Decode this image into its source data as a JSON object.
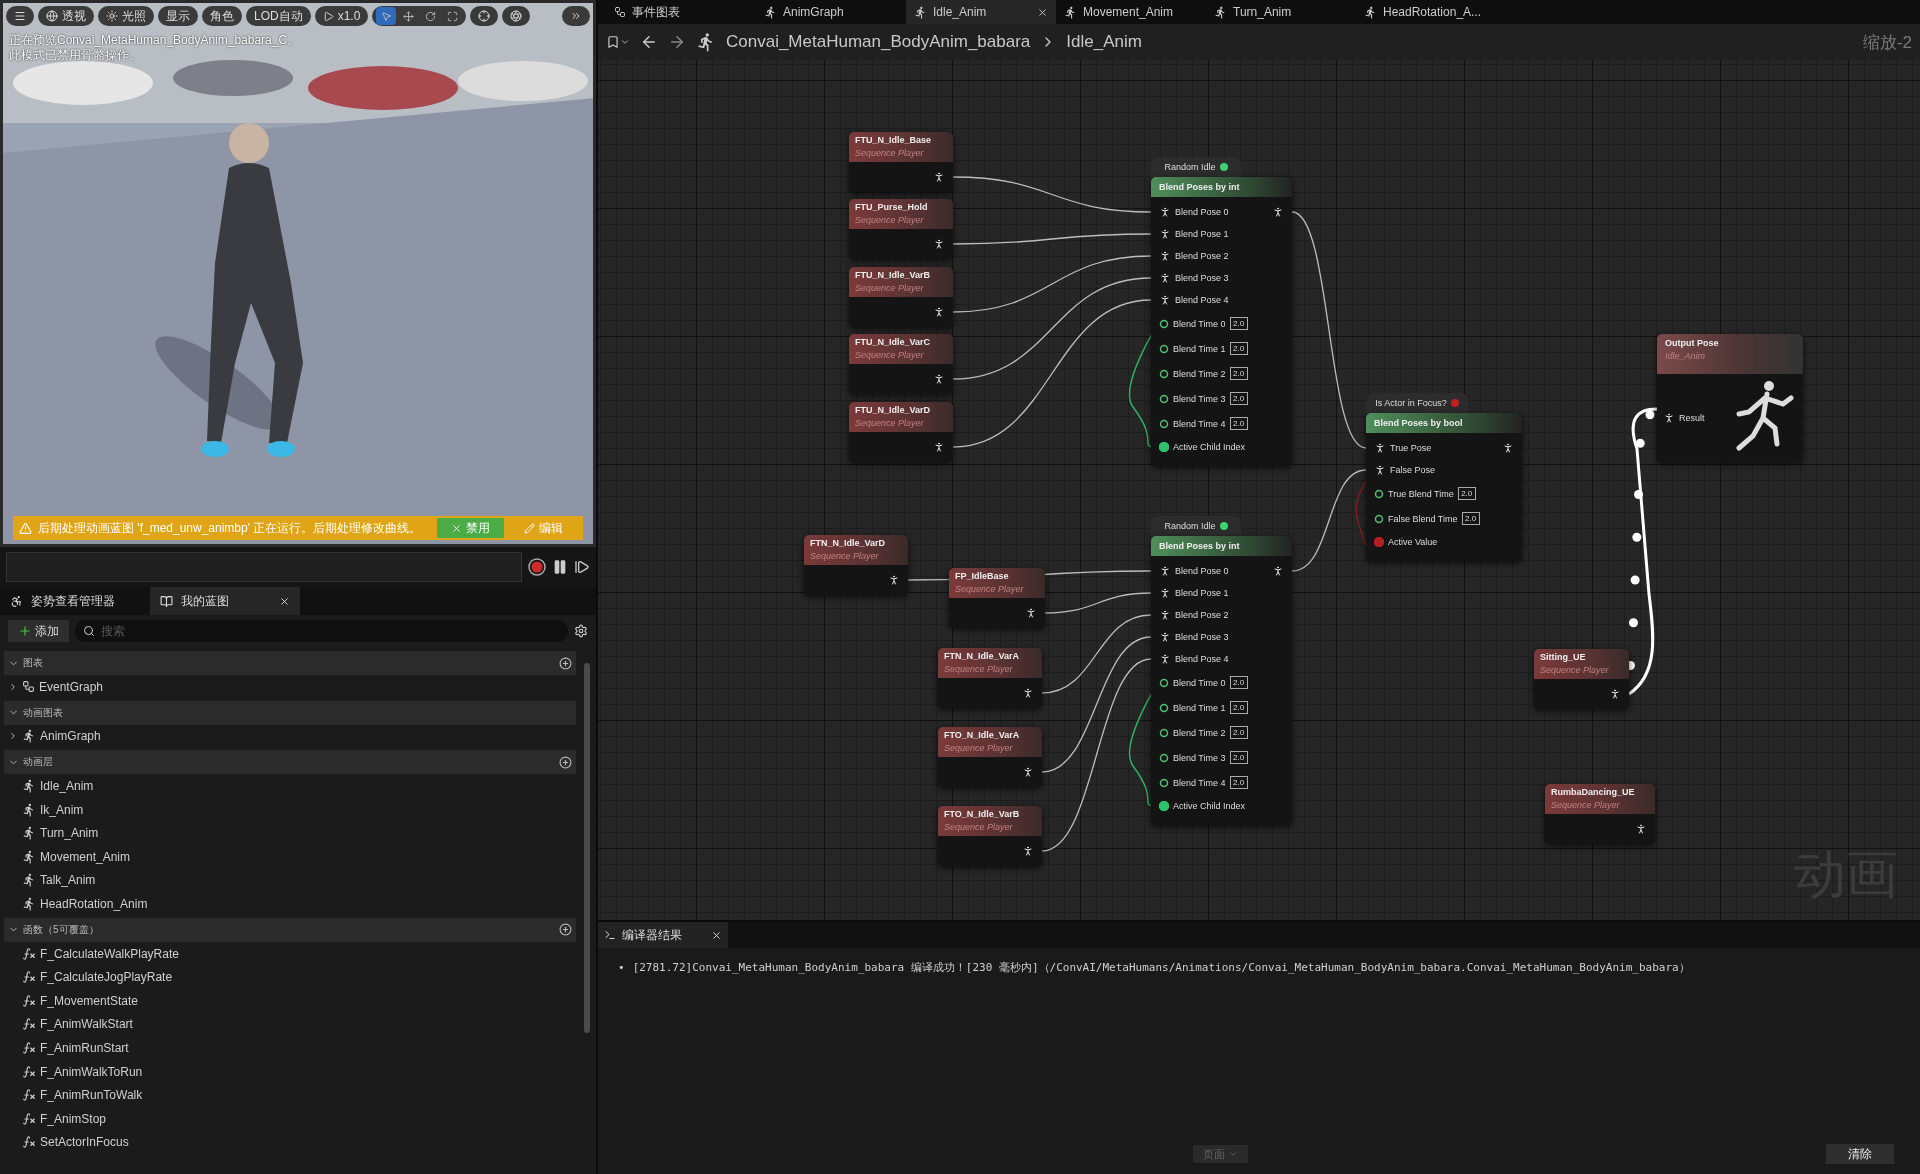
{
  "viewport": {
    "toolbar": [
      {
        "kind": "menu"
      },
      {
        "kind": "sphere",
        "label": "透视"
      },
      {
        "kind": "light",
        "label": "光照"
      },
      {
        "kind": "plain",
        "label": "显示"
      },
      {
        "kind": "plain",
        "label": "角色"
      },
      {
        "kind": "plain",
        "label": "LOD自动"
      },
      {
        "kind": "play",
        "label": "x1.0"
      }
    ],
    "tools": [
      {
        "selected": true
      },
      {
        "selected": false
      },
      {
        "selected": false
      },
      {
        "selected": false
      }
    ],
    "notice": [
      "正在预览Convai_MetaHuman_BodyAnim_babara_C。",
      "此模式已禁用骨骼操作。"
    ],
    "warning": {
      "text": "后期处理动画蓝图 'f_med_unw_animbp' 正在运行。后期处理修改曲线。",
      "buttons": [
        {
          "kind": "disable",
          "label": "禁用"
        },
        {
          "kind": "edit",
          "label": "编辑"
        }
      ]
    }
  },
  "left_tabs": [
    {
      "label": "姿势查看管理器",
      "selected": false
    },
    {
      "label": "我的蓝图",
      "selected": true
    }
  ],
  "my_blueprint": {
    "add_label": "添加",
    "search_placeholder": "搜索",
    "sections": [
      {
        "title": "图表",
        "has_add": true,
        "expanded": true,
        "items": [
          {
            "label": "EventGraph",
            "kind": "graph",
            "expanded": false
          }
        ]
      },
      {
        "title": "动画图表",
        "has_add": false,
        "expanded": true,
        "items": [
          {
            "label": "AnimGraph",
            "kind": "anim",
            "expanded": false
          }
        ]
      },
      {
        "title": "动画层",
        "has_add": true,
        "expanded": true,
        "items": [
          {
            "label": "Idle_Anim",
            "kind": "anim"
          },
          {
            "label": "Ik_Anim",
            "kind": "anim"
          },
          {
            "label": "Turn_Anim",
            "kind": "anim"
          },
          {
            "label": "Movement_Anim",
            "kind": "anim"
          },
          {
            "label": "Talk_Anim",
            "kind": "anim"
          },
          {
            "label": "HeadRotation_Anim",
            "kind": "anim"
          }
        ]
      },
      {
        "title": "函数（5可覆盖）",
        "has_add": true,
        "expanded": true,
        "items": [
          {
            "label": "F_CalculateWalkPlayRate",
            "kind": "function"
          },
          {
            "label": "F_CalculateJogPlayRate",
            "kind": "function"
          },
          {
            "label": "F_MovementState",
            "kind": "function"
          },
          {
            "label": "F_AnimWalkStart",
            "kind": "function"
          },
          {
            "label": "F_AnimRunStart",
            "kind": "function"
          },
          {
            "label": "F_AnimWalkToRun",
            "kind": "function"
          },
          {
            "label": "F_AnimRunToWalk",
            "kind": "function"
          },
          {
            "label": "F_AnimStop",
            "kind": "function"
          },
          {
            "label": "SetActorInFocus",
            "kind": "function"
          }
        ]
      }
    ]
  },
  "editor_tabs": [
    {
      "label": "事件图表",
      "kind": "event",
      "selected": false
    },
    {
      "label": "AnimGraph",
      "kind": "anim",
      "selected": false
    },
    {
      "label": "Idle_Anim",
      "kind": "anim",
      "selected": true
    },
    {
      "label": "Movement_Anim",
      "kind": "anim",
      "selected": false
    },
    {
      "label": "Turn_Anim",
      "kind": "anim",
      "selected": false
    },
    {
      "label": "HeadRotation_A...",
      "kind": "anim",
      "selected": false
    }
  ],
  "breadcrumb": [
    "Convai_MetaHuman_BodyAnim_babara",
    "Idle_Anim"
  ],
  "zoom_label": "缩放-2",
  "graph": {
    "watermark": "动画",
    "nodes": [
      {
        "kind": "sequence",
        "title": "FTU_N_Idle_Base",
        "subtitle": "Sequence Player"
      },
      {
        "kind": "sequence",
        "title": "FTU_Purse_Hold",
        "subtitle": "Sequence Player"
      },
      {
        "kind": "sequence",
        "title": "FTU_N_Idle_VarB",
        "subtitle": "Sequence Player"
      },
      {
        "kind": "sequence",
        "title": "FTU_N_Idle_VarC",
        "subtitle": "Sequence Player"
      },
      {
        "kind": "sequence",
        "title": "FTU_N_Idle_VarD",
        "subtitle": "Sequence Player"
      },
      {
        "kind": "blend_int",
        "header": "Random Idle",
        "title": "Blend Poses by int",
        "pose_pins": [
          "Blend Pose 0",
          "Blend Pose 1",
          "Blend Pose 2",
          "Blend Pose 3",
          "Blend Pose 4"
        ],
        "time_pins": [
          {
            "label": "Blend Time 0",
            "value": "2.0"
          },
          {
            "label": "Blend Time 1",
            "value": "2.0"
          },
          {
            "label": "Blend Time 2",
            "value": "2.0"
          },
          {
            "label": "Blend Time 3",
            "value": "2.0"
          },
          {
            "label": "Blend Time 4",
            "value": "2.0"
          }
        ],
        "index_pin": "Active Child Index"
      },
      {
        "kind": "sequence",
        "title": "FTN_N_Idle_VarD",
        "subtitle": "Sequence Player"
      },
      {
        "kind": "sequence",
        "title": "FP_IdleBase",
        "subtitle": "Sequence Player"
      },
      {
        "kind": "sequence",
        "title": "FTN_N_Idle_VarA",
        "subtitle": "Sequence Player"
      },
      {
        "kind": "sequence",
        "title": "FTO_N_Idle_VarA",
        "subtitle": "Sequence Player"
      },
      {
        "kind": "sequence",
        "title": "FTO_N_Idle_VarB",
        "subtitle": "Sequence Player"
      },
      {
        "kind": "blend_int",
        "header": "Random Idle",
        "title": "Blend Poses by int",
        "pose_pins": [
          "Blend Pose 0",
          "Blend Pose 1",
          "Blend Pose 2",
          "Blend Pose 3",
          "Blend Pose 4"
        ],
        "time_pins": [
          {
            "label": "Blend Time 0",
            "value": "2.0"
          },
          {
            "label": "Blend Time 1",
            "value": "2.0"
          },
          {
            "label": "Blend Time 2",
            "value": "2.0"
          },
          {
            "label": "Blend Time 3",
            "value": "2.0"
          },
          {
            "label": "Blend Time 4",
            "value": "2.0"
          }
        ],
        "index_pin": "Active Child Index"
      },
      {
        "kind": "blend_bool",
        "header": "Is Actor in Focus?",
        "title": "Blend Poses by bool",
        "pose_pins": [
          "True Pose",
          "False Pose"
        ],
        "time_pins": [
          {
            "label": "True Blend Time",
            "value": "2.0"
          },
          {
            "label": "False Blend Time",
            "value": "2.0"
          }
        ],
        "index_pin": "Active Value"
      },
      {
        "kind": "output",
        "title": "Output Pose",
        "subtitle": "Idle_Anim",
        "pin": "Result"
      },
      {
        "kind": "sequence",
        "title": "Sitting_UE",
        "subtitle": "Sequence Player"
      },
      {
        "kind": "sequence",
        "title": "RumbaDancing_UE",
        "subtitle": "Sequence Player"
      }
    ]
  },
  "compiler": {
    "tab": "编译器结果",
    "bullet": "•",
    "messages": [
      "[2781.72]Convai_MetaHuman_BodyAnim_babara 编译成功！[230 毫秒内]（/ConvAI/MetaHumans/Animations/Convai_MetaHuman_BodyAnim_babara.Convai_MetaHuman_BodyAnim_babara）"
    ],
    "page_button": "页面",
    "clear_button": "清除"
  }
}
